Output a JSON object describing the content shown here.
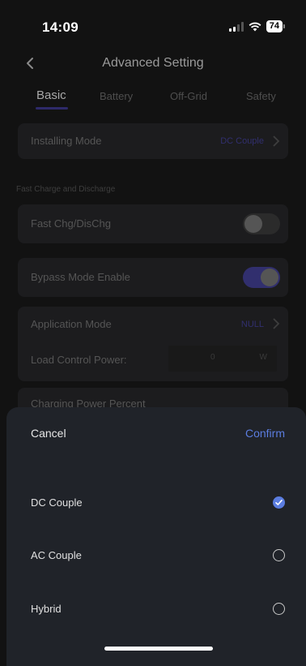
{
  "status_bar": {
    "time": "14:09",
    "battery_level": "74"
  },
  "header": {
    "title": "Advanced Setting",
    "back_icon": "chevron-left-icon"
  },
  "tabs": [
    {
      "label": "Basic",
      "active": true
    },
    {
      "label": "Battery",
      "active": false
    },
    {
      "label": "Off-Grid",
      "active": false
    },
    {
      "label": "Safety",
      "active": false
    }
  ],
  "settings": {
    "installing_mode": {
      "label": "Installing Mode",
      "value": "DC Couple"
    },
    "fast_section_label": "Fast Charge and Discharge",
    "fast_chg": {
      "label": "Fast Chg/DisChg",
      "enabled": false
    },
    "bypass": {
      "label": "Bypass Mode Enable",
      "enabled": true
    },
    "application_mode": {
      "label": "Application Mode",
      "value": "NULL"
    },
    "load_control": {
      "label": "Load Control Power:",
      "value": "0",
      "unit": "W"
    },
    "charging_percent": {
      "label": "Charging Power Percent"
    }
  },
  "sheet": {
    "cancel_label": "Cancel",
    "confirm_label": "Confirm",
    "options": [
      {
        "label": "DC Couple",
        "selected": true
      },
      {
        "label": "AC Couple",
        "selected": false
      },
      {
        "label": "Hybrid",
        "selected": false
      }
    ]
  },
  "colors": {
    "accent": "#5b7de0",
    "sheet_bg": "#202329",
    "toggle_on": "#312f6e"
  }
}
